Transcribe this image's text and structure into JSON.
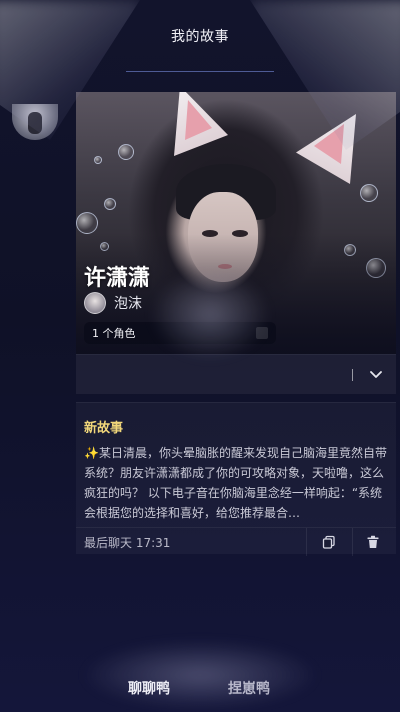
{
  "header": {
    "title": "我的故事"
  },
  "character": {
    "name": "许潇潇",
    "author": "泡沫",
    "role_chip": "1 个角色"
  },
  "story": {
    "title": "新故事",
    "sparkle": "✨",
    "text": "某日清晨，你头晕脑胀的醒来发现自己脑海里竟然自带系统？朋友许潇潇都成了你的可攻略对象，天啦噜，这么疯狂的吗？ 以下电子音在你脑海里念经一样响起：“系统会根据您的选择和喜好，给您推荐最合…",
    "last_chat": "最后聊天 17:31"
  },
  "bottom_nav": {
    "items": [
      {
        "label": "聊聊鸭"
      },
      {
        "label": "捏崽鸭"
      }
    ]
  },
  "icons": {
    "expand": "chevron-down-icon",
    "copy": "copy-icon",
    "delete": "trash-icon"
  },
  "colors": {
    "background": "#0d0f22",
    "story_title": "#f1d77a",
    "accent_line": "#7890dc"
  }
}
